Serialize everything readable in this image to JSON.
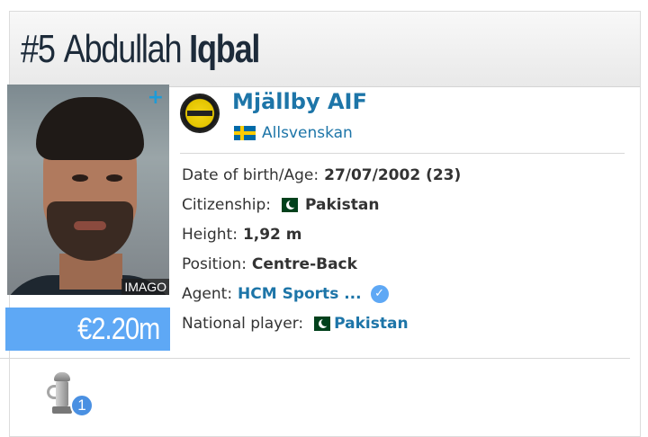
{
  "header": {
    "number": "#5",
    "first_name": "Abdullah",
    "last_name": "Iqbal"
  },
  "photo": {
    "credit": "IMAGO",
    "add_icon": "plus-icon"
  },
  "market_value": "€2.20m",
  "club": {
    "name": "Mjällby AIF",
    "league": "Allsvenskan",
    "league_flag": "sweden-flag"
  },
  "info": [
    {
      "label": "Date of birth/Age:",
      "value": "27/07/2002 (23)"
    },
    {
      "label": "Citizenship:",
      "value": "Pakistan",
      "flag": "pakistan-flag"
    },
    {
      "label": "Height:",
      "value": "1,92 m"
    },
    {
      "label": "Position:",
      "value": "Centre-Back"
    },
    {
      "label": "Agent:",
      "value": "HCM Sports ...",
      "verified_icon": "verified-check-icon"
    },
    {
      "label": "National player:",
      "value": "Pakistan",
      "flag": "pakistan-flag"
    }
  ],
  "achievements": {
    "icon": "trophy-icon",
    "count": "1"
  },
  "colors": {
    "accent_blue": "#1d75a8",
    "value_bg": "#5ea8f5",
    "title_dark": "#1d2b3a"
  }
}
